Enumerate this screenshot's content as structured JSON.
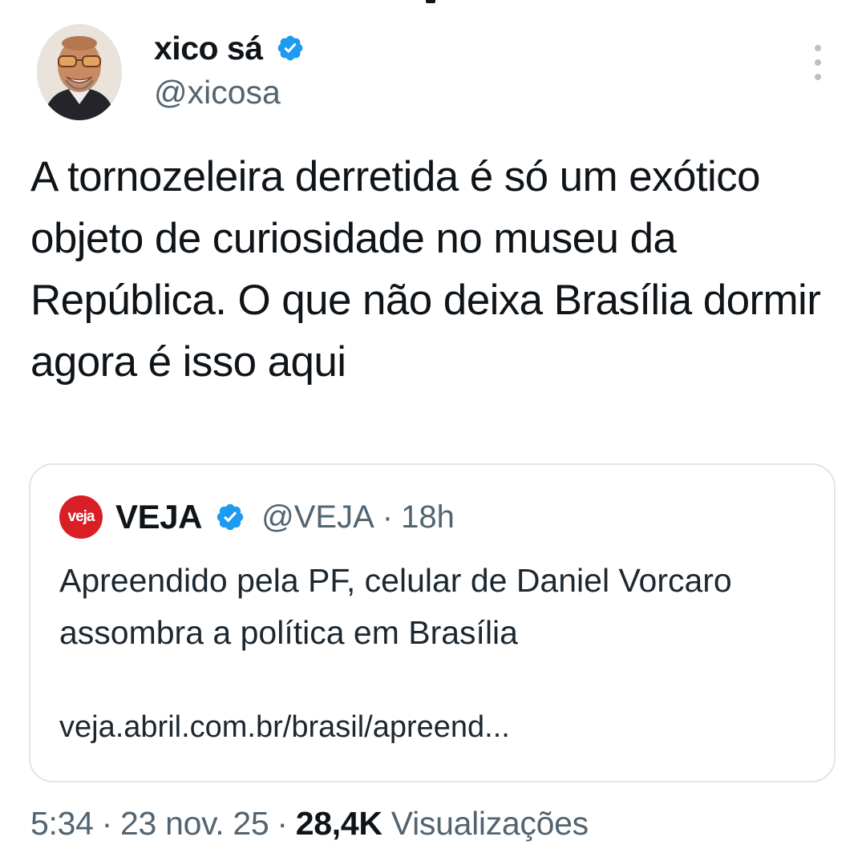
{
  "tweet": {
    "author": {
      "display_name": "xico sá",
      "handle": "@xicosa",
      "verified_icon": "verified-badge-icon",
      "avatar": "avatar-photo"
    },
    "more_icon": "more-options-icon",
    "text": "A tornozeleira derretida é só um exótico objeto de curiosidade no museu da República. O que não deixa Brasília dormir agora é isso aqui",
    "quote": {
      "logo_text": "veja",
      "display_name": "VEJA",
      "handle": "@VEJA",
      "separator": "·",
      "time": "18h",
      "text": "Apreendido pela PF, celular de Daniel Vorcaro assombra a política em Brasília",
      "link": "veja.abril.com.br/brasil/apreend..."
    },
    "meta": {
      "time": "5:34",
      "separator": "·",
      "date": "23 nov. 25",
      "views_count": "28,4K",
      "views_label": "Visualizações"
    }
  },
  "colors": {
    "text_primary": "#0f1419",
    "text_secondary": "#536471",
    "verified_blue": "#1d9bf0",
    "veja_red": "#d81f26",
    "border": "#e1e5e8"
  }
}
